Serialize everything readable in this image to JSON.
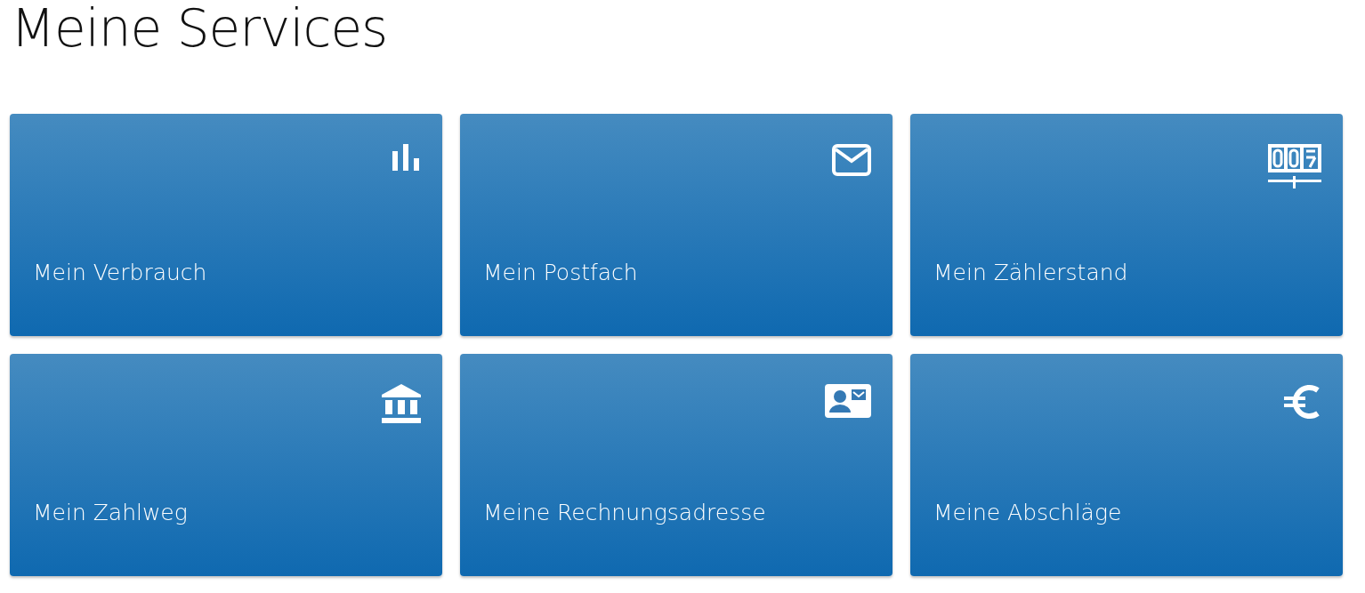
{
  "title": "Meine Services",
  "tiles": [
    {
      "label": "Mein Verbrauch"
    },
    {
      "label": "Mein Postfach"
    },
    {
      "label": "Mein Zählerstand"
    },
    {
      "label": "Mein Zahlweg"
    },
    {
      "label": "Meine Rechnungsadresse"
    },
    {
      "label": "Meine Abschläge"
    }
  ]
}
